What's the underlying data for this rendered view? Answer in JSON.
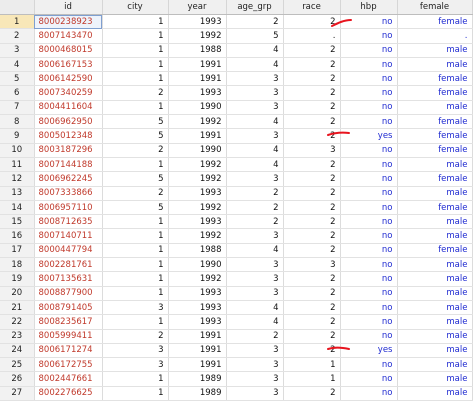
{
  "columns": [
    "id",
    "city",
    "year",
    "age_grp",
    "race",
    "hbp",
    "female"
  ],
  "rows": [
    {
      "n": "1",
      "id": "8000238923",
      "city": "1",
      "year": "1993",
      "age_grp": "2",
      "race": "2",
      "hbp": "no",
      "female": "female"
    },
    {
      "n": "2",
      "id": "8007143470",
      "city": "1",
      "year": "1992",
      "age_grp": "5",
      "race": ".",
      "hbp": "no",
      "female": "."
    },
    {
      "n": "3",
      "id": "8000468015",
      "city": "1",
      "year": "1988",
      "age_grp": "4",
      "race": "2",
      "hbp": "no",
      "female": "male"
    },
    {
      "n": "4",
      "id": "8006167153",
      "city": "1",
      "year": "1991",
      "age_grp": "4",
      "race": "2",
      "hbp": "no",
      "female": "male"
    },
    {
      "n": "5",
      "id": "8006142590",
      "city": "1",
      "year": "1991",
      "age_grp": "3",
      "race": "2",
      "hbp": "no",
      "female": "female"
    },
    {
      "n": "6",
      "id": "8007340259",
      "city": "2",
      "year": "1993",
      "age_grp": "3",
      "race": "2",
      "hbp": "no",
      "female": "female"
    },
    {
      "n": "7",
      "id": "8004411604",
      "city": "1",
      "year": "1990",
      "age_grp": "3",
      "race": "2",
      "hbp": "no",
      "female": "male"
    },
    {
      "n": "8",
      "id": "8006962950",
      "city": "5",
      "year": "1992",
      "age_grp": "4",
      "race": "2",
      "hbp": "no",
      "female": "female"
    },
    {
      "n": "9",
      "id": "8005012348",
      "city": "5",
      "year": "1991",
      "age_grp": "3",
      "race": "2",
      "hbp": "yes",
      "female": "female"
    },
    {
      "n": "10",
      "id": "8003187296",
      "city": "2",
      "year": "1990",
      "age_grp": "4",
      "race": "3",
      "hbp": "no",
      "female": "female"
    },
    {
      "n": "11",
      "id": "8007144188",
      "city": "1",
      "year": "1992",
      "age_grp": "4",
      "race": "2",
      "hbp": "no",
      "female": "male"
    },
    {
      "n": "12",
      "id": "8006962245",
      "city": "5",
      "year": "1992",
      "age_grp": "3",
      "race": "2",
      "hbp": "no",
      "female": "female"
    },
    {
      "n": "13",
      "id": "8007333866",
      "city": "2",
      "year": "1993",
      "age_grp": "2",
      "race": "2",
      "hbp": "no",
      "female": "male"
    },
    {
      "n": "14",
      "id": "8006957110",
      "city": "5",
      "year": "1992",
      "age_grp": "2",
      "race": "2",
      "hbp": "no",
      "female": "female"
    },
    {
      "n": "15",
      "id": "8008712635",
      "city": "1",
      "year": "1993",
      "age_grp": "2",
      "race": "2",
      "hbp": "no",
      "female": "male"
    },
    {
      "n": "16",
      "id": "8007140711",
      "city": "1",
      "year": "1992",
      "age_grp": "3",
      "race": "2",
      "hbp": "no",
      "female": "male"
    },
    {
      "n": "17",
      "id": "8000447794",
      "city": "1",
      "year": "1988",
      "age_grp": "4",
      "race": "2",
      "hbp": "no",
      "female": "female"
    },
    {
      "n": "18",
      "id": "8002281761",
      "city": "1",
      "year": "1990",
      "age_grp": "3",
      "race": "3",
      "hbp": "no",
      "female": "male"
    },
    {
      "n": "19",
      "id": "8007135631",
      "city": "1",
      "year": "1992",
      "age_grp": "3",
      "race": "2",
      "hbp": "no",
      "female": "male"
    },
    {
      "n": "20",
      "id": "8008877900",
      "city": "1",
      "year": "1993",
      "age_grp": "3",
      "race": "2",
      "hbp": "no",
      "female": "male"
    },
    {
      "n": "21",
      "id": "8008791405",
      "city": "3",
      "year": "1993",
      "age_grp": "4",
      "race": "2",
      "hbp": "no",
      "female": "male"
    },
    {
      "n": "22",
      "id": "8008235617",
      "city": "1",
      "year": "1993",
      "age_grp": "4",
      "race": "2",
      "hbp": "no",
      "female": "male"
    },
    {
      "n": "23",
      "id": "8005999411",
      "city": "2",
      "year": "1991",
      "age_grp": "2",
      "race": "2",
      "hbp": "no",
      "female": "male"
    },
    {
      "n": "24",
      "id": "8006171274",
      "city": "3",
      "year": "1991",
      "age_grp": "3",
      "race": "2",
      "hbp": "yes",
      "female": "male"
    },
    {
      "n": "25",
      "id": "8006172755",
      "city": "3",
      "year": "1991",
      "age_grp": "3",
      "race": "1",
      "hbp": "no",
      "female": "male"
    },
    {
      "n": "26",
      "id": "8002447661",
      "city": "1",
      "year": "1989",
      "age_grp": "3",
      "race": "1",
      "hbp": "no",
      "female": "male"
    },
    {
      "n": "27",
      "id": "8002276625",
      "city": "1",
      "year": "1989",
      "age_grp": "3",
      "race": "2",
      "hbp": "no",
      "female": "male"
    }
  ],
  "colors": {
    "id_text": "#c0392b",
    "label_text": "#1f2ad1",
    "annotation": "#e8141e"
  }
}
